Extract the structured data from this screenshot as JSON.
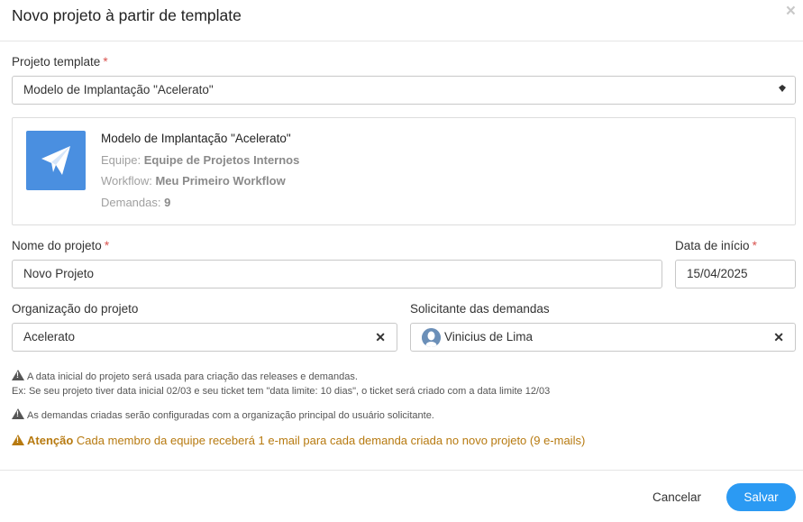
{
  "dialog": {
    "title": "Novo projeto à partir de template",
    "close_glyph": "×"
  },
  "template_field": {
    "label": "Projeto template",
    "required_mark": "*",
    "value": "Modelo de Implantação \"Acelerato\""
  },
  "template_card": {
    "icon": "paper-plane-icon",
    "icon_color": "#4a8fe0",
    "name": "Modelo de Implantação \"Acelerato\"",
    "team_label": "Equipe:",
    "team_value": "Equipe de Projetos Internos",
    "workflow_label": "Workflow:",
    "workflow_value": "Meu Primeiro Workflow",
    "demands_label": "Demandas:",
    "demands_value": "9"
  },
  "project_name": {
    "label": "Nome do projeto",
    "required_mark": "*",
    "value": "Novo Projeto"
  },
  "start_date": {
    "label": "Data de início",
    "required_mark": "*",
    "value": "15/04/2025"
  },
  "organization": {
    "label": "Organização do projeto",
    "value": "Acelerato",
    "clear_glyph": "✕"
  },
  "requester": {
    "label": "Solicitante das demandas",
    "value": "Vinicius de Lima",
    "clear_glyph": "✕"
  },
  "notes": {
    "date_note": "A data inicial do projeto será usada para criação das releases e demandas.",
    "date_example": "Ex: Se seu projeto tiver data inicial 02/03 e seu ticket tem \"data limite: 10 dias\", o ticket será criado com a data limite 12/03",
    "org_note": "As demandas criadas serão configuradas com a organização principal do usuário solicitante.",
    "attention_label": "Atenção",
    "attention_text": "Cada membro da equipe receberá 1 e-mail para cada demanda criada no novo projeto (9 e-mails)",
    "attention_color": "#b77a10"
  },
  "footer": {
    "cancel_label": "Cancelar",
    "save_label": "Salvar",
    "save_color": "#2b9af3"
  }
}
